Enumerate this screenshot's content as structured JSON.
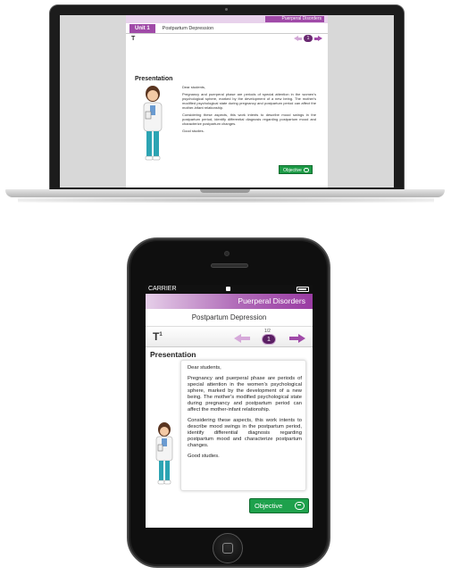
{
  "course_name": "Puerperal Disorders",
  "unit": {
    "label": "Unit 1",
    "title": "Postpartum Depression"
  },
  "topic_icon": "T",
  "topic_icon_small": "1",
  "navigation": {
    "current_page": "1",
    "page_count_label": "1/2",
    "prev_icon": "arrow-left-icon",
    "next_icon": "arrow-right-icon"
  },
  "status_bar": {
    "carrier": "CARRIER"
  },
  "section_heading": "Presentation",
  "body": {
    "greeting": "Dear students,",
    "paragraph1": "Pregnancy and puerperal phase are periods of special attention in the women's psychological sphere, marked by the development of a new being. The mother's modified psychological state during pregnancy and postpartum period can affect the mother-infant relationship.",
    "paragraph2": "Considering these aspects, this work intents to describe mood swings in the postpartum period, identify differential diagnosis regarding postpartum mood and characterize postpartum changes.",
    "closing": "Good studies."
  },
  "objective_button": {
    "label": "Objective",
    "icon": "chat-bubble-icon"
  },
  "colors": {
    "accent": "#a04aa8",
    "accent_dark": "#5a1f63",
    "button_green": "#1ea14c"
  }
}
